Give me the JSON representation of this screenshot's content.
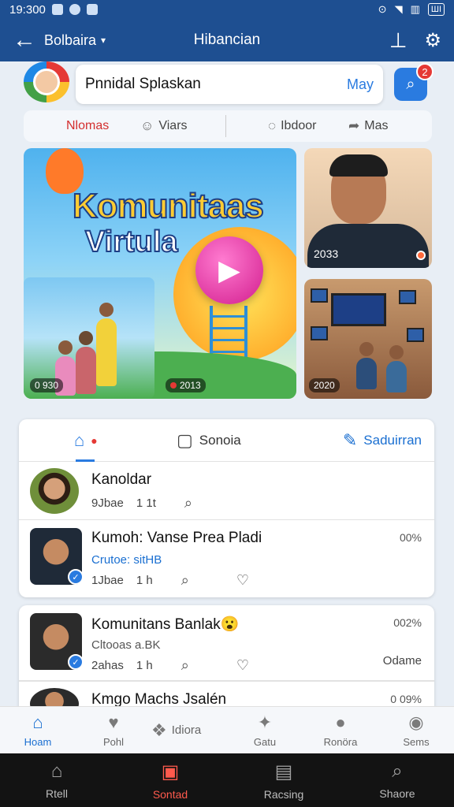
{
  "status_bar": {
    "time": "19:300",
    "battery": "ШІ"
  },
  "app_bar": {
    "account": "Bolbaira",
    "title": "Hibancian",
    "back_icon": "arrow-left-icon",
    "upload_icon": "upload-icon",
    "settings_icon": "gear-icon"
  },
  "search": {
    "value": "Pnnidal Splaskan",
    "suffix": "May",
    "badge_count": "2"
  },
  "filters": [
    {
      "label": "Nlomas",
      "active": true
    },
    {
      "label": "Viars",
      "icon": "smile-icon"
    },
    {
      "label": "Ibdoor",
      "icon": "chat-icon"
    },
    {
      "label": "Mas",
      "icon": "share-icon"
    }
  ],
  "media": {
    "hero_title": "Komunitaas",
    "hero_subtitle": "Virtula",
    "hero_sub_time": "0 930",
    "hero_live_time": "2013",
    "side1_time": "2033",
    "side2_time": "2020"
  },
  "tabs": [
    {
      "label": "",
      "icon": "person-pin-icon"
    },
    {
      "label": "Sonoia",
      "icon": "chat-square-icon"
    },
    {
      "label": "Saduirran",
      "icon": "edit-icon"
    }
  ],
  "feed": [
    {
      "name": "Kanoldar",
      "time": "9Jbae",
      "duration": "1 1t"
    },
    {
      "name": "Kumoh: Vanse Prea Pladi",
      "sub": "Crutoe: sitHB",
      "time": "1Jbae",
      "duration": "1 h",
      "percent": "00%"
    },
    {
      "name": "Komunitans Banlak😮",
      "sub": "Cltooas a.BK",
      "time": "2ahas",
      "duration": "1 h",
      "percent": "002%",
      "action": "Odame"
    },
    {
      "name": "Kmgo Machs Jsalén",
      "percent": "0 09%"
    }
  ],
  "bottom_nav": [
    {
      "label": "Hoam",
      "icon": "home-icon",
      "active": true
    },
    {
      "label": "Pohl",
      "icon": "heart-shield-icon"
    },
    {
      "label": "Idiora",
      "icon": "people-icon"
    },
    {
      "label": "Gatu",
      "icon": "star-burst-icon"
    },
    {
      "label": "Ronöra",
      "icon": "chat-bubble-icon"
    },
    {
      "label": "Sems",
      "icon": "user-icon"
    }
  ],
  "system_nav": [
    {
      "label": "Rtell",
      "icon": "house-icon"
    },
    {
      "label": "Sontad",
      "icon": "window-icon",
      "active": true
    },
    {
      "label": "Racsing",
      "icon": "monitor-icon"
    },
    {
      "label": "Shaore",
      "icon": "search-icon"
    }
  ]
}
